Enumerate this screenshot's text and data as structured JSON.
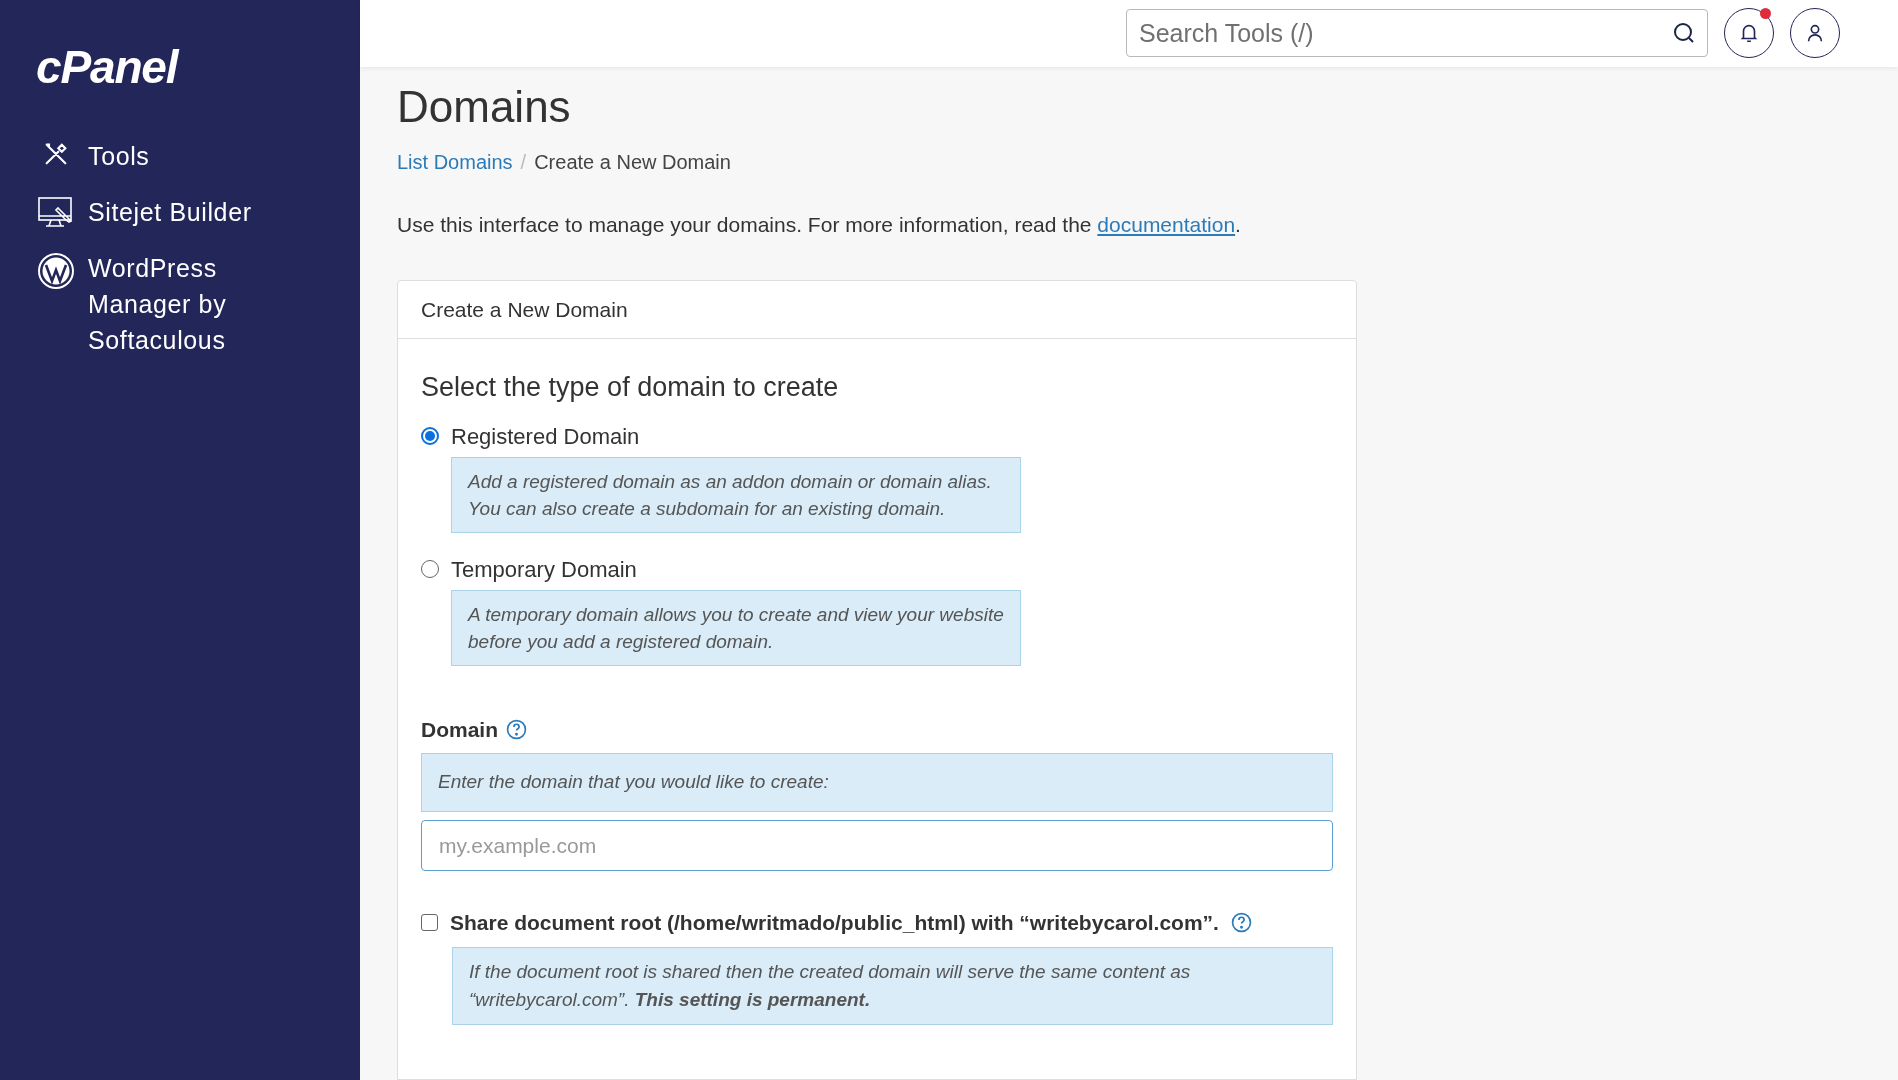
{
  "sidebar": {
    "logo": "cPanel",
    "items": [
      {
        "kind": "tools",
        "label": "Tools"
      },
      {
        "kind": "sitejet",
        "label": "Sitejet Builder"
      },
      {
        "kind": "wordpress",
        "label": "WordPress Manager by Softaculous"
      }
    ]
  },
  "header": {
    "search": {
      "placeholder": "Search Tools (/)"
    },
    "notifications": {
      "unread": true
    }
  },
  "page": {
    "title": "Domains",
    "separator": "/",
    "breadcrumbs": [
      {
        "label": "List Domains",
        "link": true
      },
      {
        "label": "Create a New Domain",
        "link": false
      }
    ],
    "intro": {
      "text": "Use this interface to manage your domains. For more information, read the ",
      "link": "documentation",
      "end": "."
    }
  },
  "card": {
    "title": "Create a New Domain",
    "heading": "Select the type of domain to create",
    "options": [
      {
        "label": "Registered Domain",
        "selected": true,
        "help": "Add a registered domain as an addon domain or domain alias. You can also create a subdomain for an existing domain."
      },
      {
        "label": "Temporary Domain",
        "selected": false,
        "help": "A temporary domain allows you to create and view your website before you add a registered domain."
      }
    ],
    "domain": {
      "label": "Domain",
      "hint": "Enter the domain that you would like to create:",
      "placeholder": "my.example.com"
    },
    "share": {
      "label": "Share document root (/home/writmado/public_html) with “writebycarol.com”.",
      "checked": false,
      "help": "If the document root is shared then the created domain will serve the same content as “writebycarol.com”. **This setting is permanent.**"
    }
  }
}
